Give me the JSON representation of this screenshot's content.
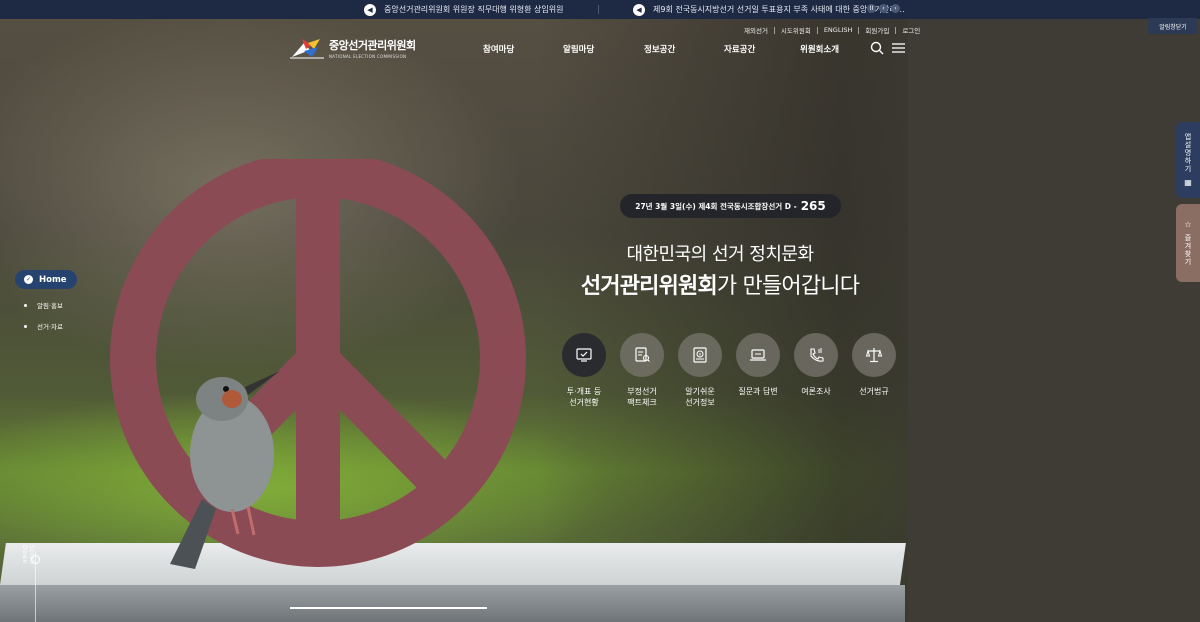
{
  "notices": [
    {
      "text": "중앙선거관리위원회 위원장 직무대행 위형환 상임위원"
    },
    {
      "text": "제9회 전국동시지방선거 선거일 투표용지 부족 사태에 대한 중앙선거관리…"
    }
  ],
  "notice_controls": {
    "pause": "II",
    "prev": "‹",
    "next": "›"
  },
  "quick_menu_label": "알림창닫기",
  "logo": {
    "ko": "중앙선거관리위원회",
    "en": "NATIONAL ELECTION COMMISSION"
  },
  "util_links": [
    "재외선거",
    "시도위원회",
    "ENGLISH",
    "회원가입",
    "로그인"
  ],
  "gnb": [
    "참여마당",
    "알림마당",
    "정보공간",
    "자료공간",
    "위원회소개"
  ],
  "dday": {
    "text": "27년 3월 3일(수) 제4회 전국동시조합장선거 D -",
    "count": "265"
  },
  "headline": {
    "line1": "대한민국의 선거 정치문화",
    "line2_bold": "선거관리위원회",
    "line2_rest": "가 만들어갑니다"
  },
  "quick_icons": [
    {
      "label": "투·개표 등\n선거현황",
      "icon": "monitor-check-icon"
    },
    {
      "label": "부정선거\n팩트체크",
      "icon": "document-search-icon"
    },
    {
      "label": "알기쉬운\n선거정보",
      "icon": "book-info-icon"
    },
    {
      "label": "질문과 답변",
      "icon": "laptop-chat-icon"
    },
    {
      "label": "여론조사",
      "icon": "phone-chart-icon"
    },
    {
      "label": "선거법규",
      "icon": "scale-icon"
    }
  ],
  "left_nav": {
    "home": "Home",
    "items": [
      "알림·홍보",
      "선거·자료"
    ]
  },
  "scroll_label": "Scroll Down",
  "side_tabs": [
    {
      "label": "앱설명하기",
      "icon": "qr-icon",
      "icon_glyph": "▦"
    },
    {
      "label": "즐겨찾기",
      "icon": "star-icon",
      "icon_glyph": "☆"
    }
  ],
  "colors": {
    "topbar": "#1e2a44",
    "home_pill": "#25436e",
    "side_tab_blue": "#2c3d60",
    "side_tab_rose": "#8a6e64",
    "peace_sign": "#8b4b55"
  }
}
